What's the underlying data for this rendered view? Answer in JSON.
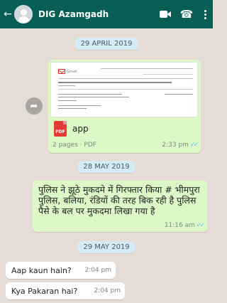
{
  "header": {
    "title": "DIG Azamgadh"
  },
  "icons": {
    "back": "arrow-left-icon",
    "video": "video-call-icon",
    "phone": "phone-icon",
    "menu": "more-vert-icon",
    "forward": "forward-icon"
  },
  "dates": [
    "29 APRIL 2019",
    "28 MAY 2019",
    "29 MAY 2019"
  ],
  "doc_message": {
    "filename": "app",
    "file_type_badge": "PDF",
    "meta": "2 pages · PDF",
    "time": "2:33 pm",
    "preview": {
      "gmail": "Gmail"
    }
  },
  "text_message": {
    "text": "पुलिस ने झूठे मुकदमे में गिरफ्तार किया # भीमपुरा पुलिस, बलिया, रंडियों की तरह बिक रही है पुलिस पैसे के बल पर मुकदमा लिखा गया है",
    "time": "11:16 am"
  },
  "incoming": [
    {
      "text": "Aap kaun hain?",
      "time": "2:04 pm"
    },
    {
      "text": "Kya Pakaran hai?",
      "time": "2:04 pm"
    }
  ],
  "colors": {
    "header": "#075e54",
    "outgoing": "#dcf8c6",
    "incoming": "#ffffff",
    "background": "#e5ddd5",
    "read_ticks": "#4fc3f7"
  }
}
